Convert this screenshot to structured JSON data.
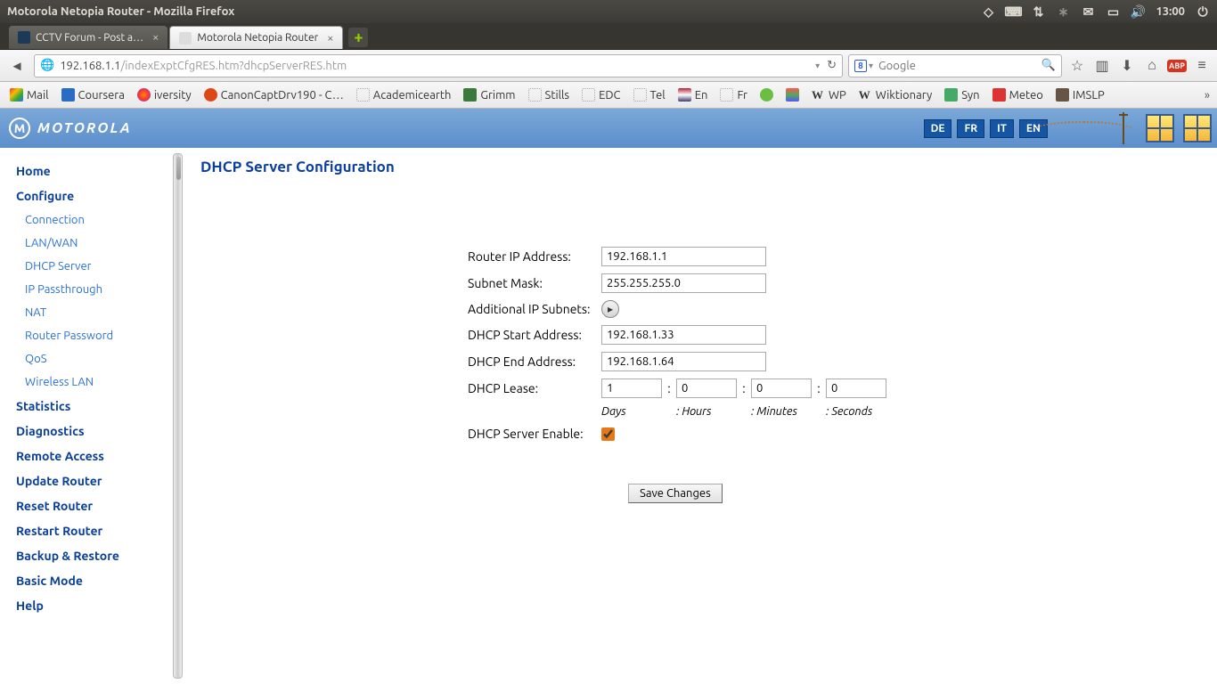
{
  "os": {
    "window_title": "Motorola Netopia Router - Mozilla Firefox",
    "clock": "13:00"
  },
  "tabs": {
    "inactive": "CCTV Forum - Post a…",
    "active": "Motorola Netopia Router"
  },
  "url": {
    "host": "192.168.1.1",
    "path": "/indexExptCfgRES.htm?dhcpServerRES.htm"
  },
  "search": {
    "placeholder": "Google"
  },
  "bookmarks": {
    "mail": "Mail",
    "coursera": "Coursera",
    "iversity": "iversity",
    "canon": "CanonCaptDrv190 - C…",
    "ae": "Academicearth",
    "grimm": "Grimm",
    "stills": "Stills",
    "edc": "EDC",
    "tel": "Tel",
    "en": "En",
    "fr": "Fr",
    "wp": "WP",
    "wikt": "Wiktionary",
    "syn": "Syn",
    "meteo": "Meteo",
    "imslp": "IMSLP"
  },
  "router": {
    "brand": "MOTOROLA",
    "langs": {
      "de": "DE",
      "fr": "FR",
      "it": "IT",
      "en": "EN"
    },
    "nav": {
      "home": "Home",
      "configure": "Configure",
      "connection": "Connection",
      "lanwan": "LAN/WAN",
      "dhcp": "DHCP Server",
      "ippass": "IP Passthrough",
      "nat": "NAT",
      "rpass": "Router Password",
      "qos": "QoS",
      "wlan": "Wireless LAN",
      "stats": "Statistics",
      "diag": "Diagnostics",
      "remote": "Remote Access",
      "update": "Update Router",
      "reset": "Reset Router",
      "restart": "Restart Router",
      "backup": "Backup & Restore",
      "basic": "Basic Mode",
      "help": "Help"
    },
    "page": {
      "title": "DHCP Server Configuration",
      "labels": {
        "ip": "Router IP Address:",
        "mask": "Subnet Mask:",
        "subnets": "Additional IP Subnets:",
        "start": "DHCP Start Address:",
        "end": "DHCP End Address:",
        "lease": "DHCP Lease:",
        "enable": "DHCP Server Enable:",
        "days": "Days",
        "hours": "Hours",
        "minutes": "Minutes",
        "seconds": "Seconds"
      },
      "values": {
        "ip": "192.168.1.1",
        "mask": "255.255.255.0",
        "start": "192.168.1.33",
        "end": "192.168.1.64",
        "lease_days": "1",
        "lease_hours": "0",
        "lease_min": "0",
        "lease_sec": "0"
      },
      "save": "Save Changes"
    }
  }
}
